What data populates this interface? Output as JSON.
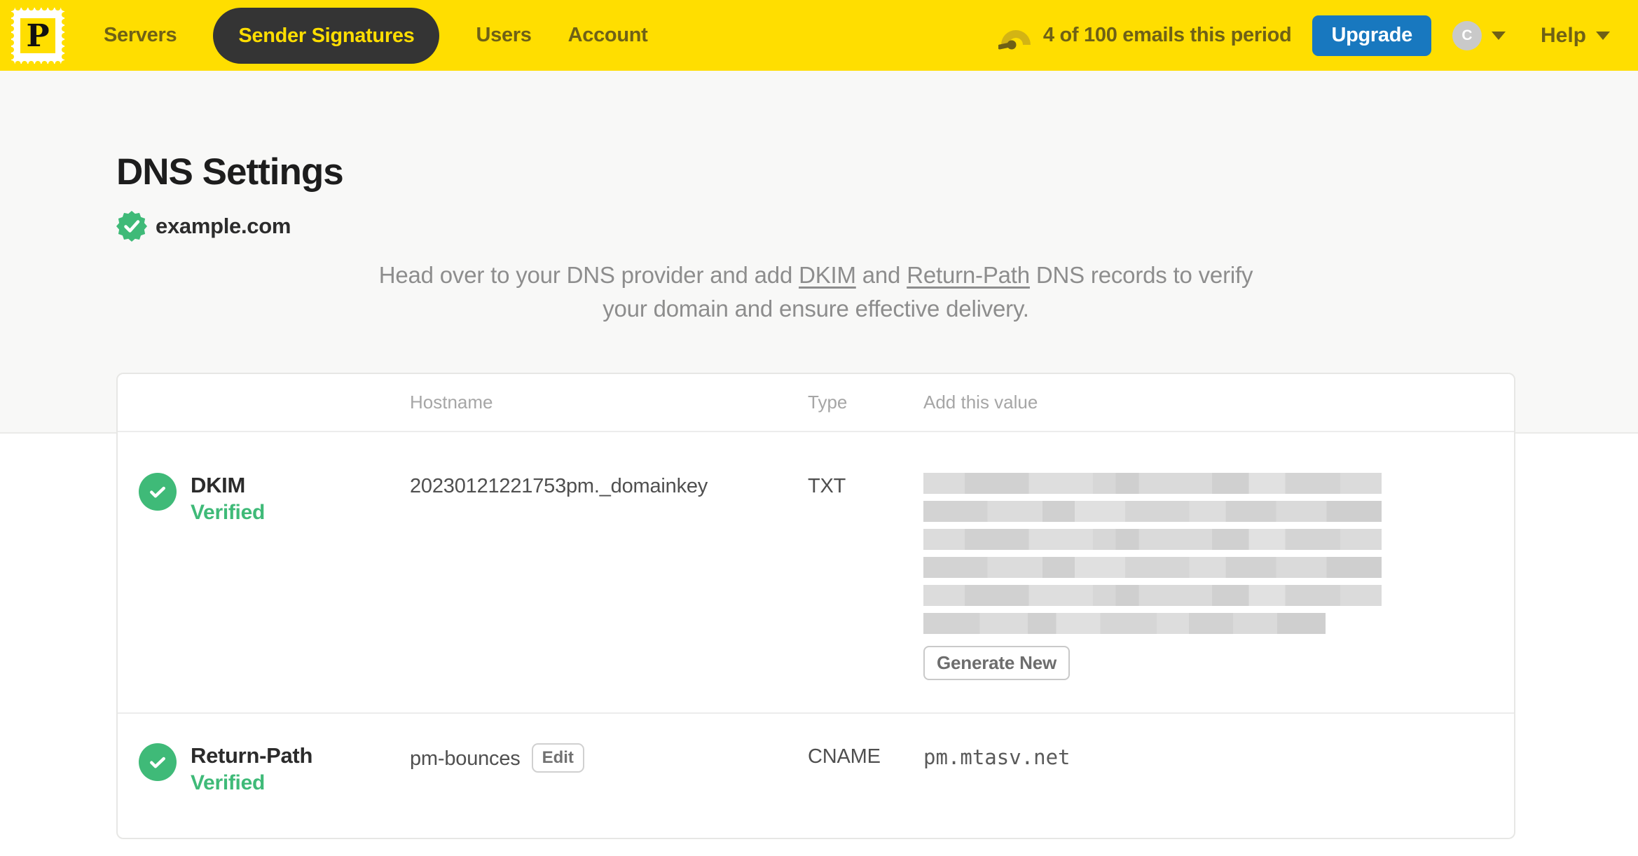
{
  "nav": {
    "logo": {
      "letter": "P"
    },
    "items": [
      {
        "label": "Servers",
        "active": false
      },
      {
        "label": "Sender Signatures",
        "active": true
      },
      {
        "label": "Users",
        "active": false
      },
      {
        "label": "Account",
        "active": false
      }
    ],
    "usage_text": "4 of 100 emails this period",
    "upgrade_label": "Upgrade",
    "avatar_initial": "C",
    "help_label": "Help"
  },
  "page": {
    "title": "DNS Settings",
    "domain": "example.com",
    "description": {
      "before_dkim": "Head over to your DNS provider and add ",
      "dkim_link": "DKIM",
      "between": " and ",
      "return_path_link": "Return-Path",
      "after": " DNS records to verify your domain and ensure effective delivery."
    }
  },
  "table": {
    "headers": {
      "hostname": "Hostname",
      "type": "Type",
      "value": "Add this value"
    },
    "rows": [
      {
        "name": "DKIM",
        "status": "Verified",
        "hostname": "20230121221753pm._domainkey",
        "type": "TXT",
        "value_redacted": true,
        "redacted_lines": 6,
        "action_label": "Generate New"
      },
      {
        "name": "Return-Path",
        "status": "Verified",
        "hostname": "pm-bounces",
        "edit_label": "Edit",
        "type": "CNAME",
        "value": "pm.mtasv.net"
      }
    ]
  },
  "icons": {
    "logo": "postage-stamp-icon",
    "usage": "gauge-icon",
    "domain": "verified-seal-icon",
    "status": "check-circle-icon",
    "dropdown": "caret-down-icon"
  },
  "colors": {
    "brand_yellow": "#FFDE00",
    "nav_text_olive": "#6F6116",
    "nav_active_bg": "#343434",
    "upgrade_blue": "#1878BF",
    "verified_green": "#3FBA78",
    "page_bg_top": "#F8F8F7",
    "redaction_gray": "#D9D9D9",
    "text_dark": "#2B2B2B",
    "text_gray": "#8D8D8D"
  }
}
